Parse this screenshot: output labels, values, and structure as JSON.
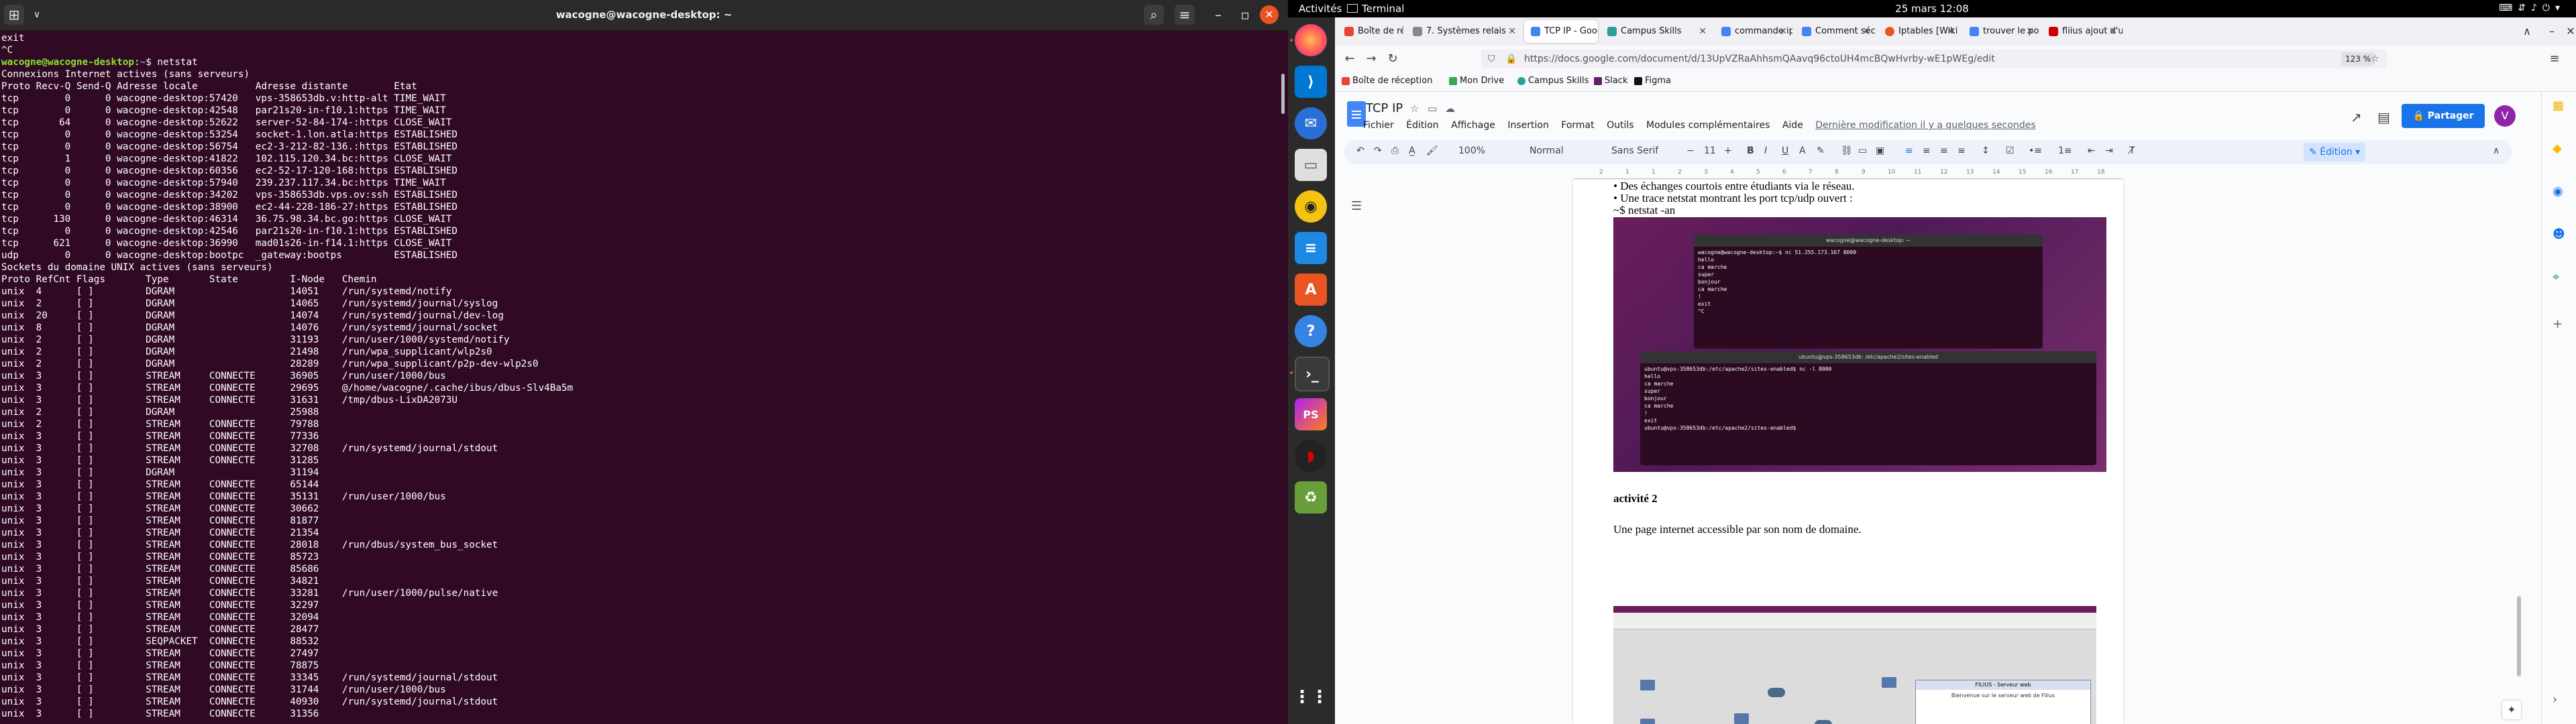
{
  "terminal": {
    "title": "wacogne@wacogne-desktop: ~",
    "lines_before_prompt": "exit\n^C",
    "prompt_user": "wacogne@wacogne-desktop",
    "prompt_path": "~",
    "prompt_cmd": "$ netstat",
    "output": "Connexions Internet actives (sans serveurs)\nProto Recv-Q Send-Q Adresse locale          Adresse distante        Etat\ntcp        0      0 wacogne-desktop:57420   vps-358653db.v:http-alt TIME_WAIT\ntcp        0      0 wacogne-desktop:42548   par21s20-in-f10.1:https TIME_WAIT\ntcp       64      0 wacogne-desktop:52622   server-52-84-174-:https CLOSE_WAIT\ntcp        0      0 wacogne-desktop:53254   socket-1.lon.atla:https ESTABLISHED\ntcp        0      0 wacogne-desktop:56754   ec2-3-212-82-136.:https ESTABLISHED\ntcp        1      0 wacogne-desktop:41822   102.115.120.34.bc:https CLOSE_WAIT\ntcp        0      0 wacogne-desktop:60356   ec2-52-17-120-168:https ESTABLISHED\ntcp        0      0 wacogne-desktop:57940   239.237.117.34.bc:https TIME_WAIT\ntcp        0      0 wacogne-desktop:34202   vps-358653db.vps.ov:ssh ESTABLISHED\ntcp        0      0 wacogne-desktop:38900   ec2-44-228-186-27:https ESTABLISHED\ntcp      130      0 wacogne-desktop:46314   36.75.98.34.bc.go:https CLOSE_WAIT\ntcp        0      0 wacogne-desktop:42546   par21s20-in-f10.1:https ESTABLISHED\ntcp      621      0 wacogne-desktop:36990   mad01s26-in-f14.1:https CLOSE_WAIT\nudp        0      0 wacogne-desktop:bootpc  _gateway:bootps         ESTABLISHED\nSockets du domaine UNIX actives (sans serveurs)\nProto RefCnt Flags       Type       State         I-Node   Chemin\nunix  4      [ ]         DGRAM                    14051    /run/systemd/notify\nunix  2      [ ]         DGRAM                    14065    /run/systemd/journal/syslog\nunix  20     [ ]         DGRAM                    14074    /run/systemd/journal/dev-log\nunix  8      [ ]         DGRAM                    14076    /run/systemd/journal/socket\nunix  2      [ ]         DGRAM                    31193    /run/user/1000/systemd/notify\nunix  2      [ ]         DGRAM                    21498    /run/wpa_supplicant/wlp2s0\nunix  2      [ ]         DGRAM                    28289    /run/wpa_supplicant/p2p-dev-wlp2s0\nunix  3      [ ]         STREAM     CONNECTE      36905    /run/user/1000/bus\nunix  3      [ ]         STREAM     CONNECTE      29695    @/home/wacogne/.cache/ibus/dbus-Slv4Ba5m\nunix  3      [ ]         STREAM     CONNECTE      31631    /tmp/dbus-LixDA2073U\nunix  2      [ ]         DGRAM                    25988\nunix  2      [ ]         STREAM     CONNECTE      79788\nunix  3      [ ]         STREAM     CONNECTE      77336\nunix  3      [ ]         STREAM     CONNECTE      32708    /run/systemd/journal/stdout\nunix  3      [ ]         STREAM     CONNECTE      31285\nunix  3      [ ]         DGRAM                    31194\nunix  3      [ ]         STREAM     CONNECTE      65144\nunix  3      [ ]         STREAM     CONNECTE      35131    /run/user/1000/bus\nunix  3      [ ]         STREAM     CONNECTE      30662\nunix  3      [ ]         STREAM     CONNECTE      81877\nunix  3      [ ]         STREAM     CONNECTE      21354\nunix  3      [ ]         STREAM     CONNECTE      28018    /run/dbus/system_bus_socket\nunix  3      [ ]         STREAM     CONNECTE      85723\nunix  3      [ ]         STREAM     CONNECTE      85686\nunix  3      [ ]         STREAM     CONNECTE      34821\nunix  3      [ ]         STREAM     CONNECTE      33281    /run/user/1000/pulse/native\nunix  3      [ ]         STREAM     CONNECTE      32297\nunix  3      [ ]         STREAM     CONNECTE      32094\nunix  3      [ ]         STREAM     CONNECTE      28477\nunix  3      [ ]         SEQPACKET  CONNECTE      88532\nunix  3      [ ]         STREAM     CONNECTE      27497\nunix  3      [ ]         STREAM     CONNECTE      78875\nunix  3      [ ]         STREAM     CONNECTE      33345    /run/systemd/journal/stdout\nunix  3      [ ]         STREAM     CONNECTE      31744    /run/user/1000/bus\nunix  3      [ ]         STREAM     CONNECTE      40930    /run/systemd/journal/stdout\nunix  3      [ ]         STREAM     CONNECTE      31356"
  },
  "topbar": {
    "activities": "Activités",
    "app_name": "Terminal",
    "clock": "25 mars  12:08"
  },
  "dock": {
    "items": [
      "firefox-icon",
      "vscode-icon",
      "thunderbird-icon",
      "files-icon",
      "rhythmbox-icon",
      "libreoffice-writer-icon",
      "software-center-icon",
      "help-icon",
      "terminal-icon",
      "phpstorm-icon",
      "cisco-packet-tracer-icon",
      "trash-icon",
      "show-apps-icon"
    ]
  },
  "browser": {
    "tabs": [
      {
        "label": "Boîte de réception",
        "color": "#ea4335",
        "active": false
      },
      {
        "label": "7. Systèmes relais",
        "color": "#888888",
        "active": false
      },
      {
        "label": "TCP IP - Google Do",
        "color": "#4285f4",
        "active": true
      },
      {
        "label": "Campus Skills",
        "color": "#2aa198",
        "active": false
      },
      {
        "label": "commande ip linu",
        "color": "#4285f4",
        "active": false
      },
      {
        "label": "Comment sécuris",
        "color": "#4285f4",
        "active": false
      },
      {
        "label": "Iptables [Wiki ubu",
        "color": "#e95420",
        "active": false
      },
      {
        "label": "trouver le port d'u",
        "color": "#4285f4",
        "active": false
      },
      {
        "label": "fliius ajout d'un s",
        "color": "#cc0000",
        "active": false
      }
    ],
    "url": "https://docs.google.com/document/d/13UpVZRaAhhsmQAavq96ctoUH4mcBQwHvrby-wE1pWEg/edit",
    "zoom": "123 %",
    "bookmarks": [
      "Boîte de réception",
      "Mon Drive",
      "Campus Skills",
      "Slack",
      "Figma"
    ]
  },
  "docs": {
    "title": "TCP IP",
    "menu": [
      "Fichier",
      "Édition",
      "Affichage",
      "Insertion",
      "Format",
      "Outils",
      "Modules complémentaires",
      "Aide"
    ],
    "last_edit": "Dernière modification il y a quelques secondes",
    "share": "Partager",
    "avatar_letter": "V",
    "toolbar": {
      "zoom": "100%",
      "style": "Normal",
      "font": "Sans Serif",
      "size": "11",
      "mode": "Édition"
    },
    "ruler": [
      "2",
      "1",
      "1",
      "2",
      "3",
      "4",
      "5",
      "6",
      "7",
      "8",
      "9",
      "10",
      "11",
      "12",
      "13",
      "14",
      "15",
      "16",
      "17",
      "18"
    ],
    "lines": {
      "bullet1": "• Des échanges courtois entre étudiants via le réseau.",
      "bullet2": "• Une trace netstat montrant les port tcp/udp ouvert :",
      "cmd": "~$ netstat -an",
      "heading": "activité 2",
      "para": "Une page internet accessible par son nom de domaine."
    },
    "screenshot1": {
      "win1_title": "wacogne@wacogne-desktop: ~",
      "win1_text": "wacogne@wacogne-desktop:~$ nc 51.255.173.167 8000\nhello\nca marche\nsuper\nbonjour\nca marche\n!\nexit\n^C",
      "win2_title": "ubuntu@vps-358653db: /etc/apache2/sites-enabled",
      "win2_text": "ubuntu@vps-358653db:/etc/apache2/sites-enabled$ nc -l 8000\nhello\nca marche\nsuper\nbonjour\nca marche\n!\nexit\nubuntu@vps-358653db:/etc/apache2/sites-enabled$ "
    },
    "screenshot2": {
      "panel_title": "FILIUS - Serveur web",
      "panel_text": "Bienvenue sur le serveur web de Filius"
    }
  }
}
